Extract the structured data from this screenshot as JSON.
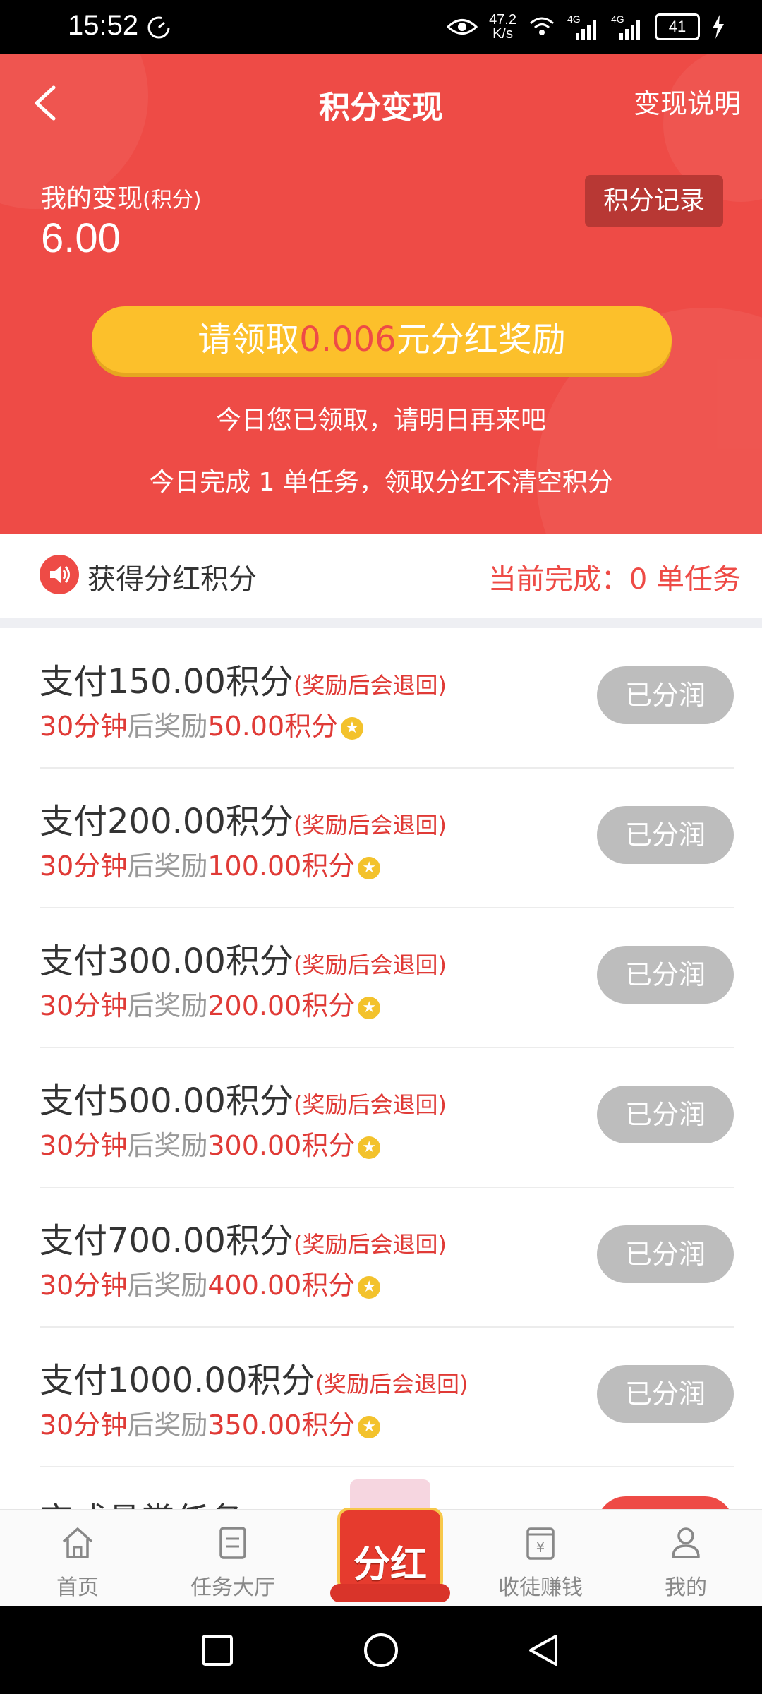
{
  "status_bar": {
    "time": "15:52",
    "net_speed_value": "47.2",
    "net_speed_unit": "K/s",
    "signal_label_1": "4G",
    "signal_label_2": "4G",
    "battery": "41"
  },
  "nav": {
    "title": "积分变现",
    "right_link": "变现说明"
  },
  "summary": {
    "label": "我的变现",
    "label_unit": "(积分)",
    "value": "6.00",
    "record_button": "积分记录"
  },
  "claim": {
    "prefix": "请领取",
    "amount": "0.006",
    "suffix": "元分红奖励"
  },
  "info": {
    "line1": "今日您已领取，请明日再来吧",
    "line2": "今日完成 1 单任务，领取分红不清空积分"
  },
  "section": {
    "title": "获得分红积分",
    "progress": "当前完成：0 单任务"
  },
  "tasks": [
    {
      "pay": "支付150.00积分",
      "note": "(奖励后会退回)",
      "time": "30分钟",
      "mid": "后奖励",
      "reward": "50.00积分",
      "status": "已分润"
    },
    {
      "pay": "支付200.00积分",
      "note": "(奖励后会退回)",
      "time": "30分钟",
      "mid": "后奖励",
      "reward": "100.00积分",
      "status": "已分润"
    },
    {
      "pay": "支付300.00积分",
      "note": "(奖励后会退回)",
      "time": "30分钟",
      "mid": "后奖励",
      "reward": "200.00积分",
      "status": "已分润"
    },
    {
      "pay": "支付500.00积分",
      "note": "(奖励后会退回)",
      "time": "30分钟",
      "mid": "后奖励",
      "reward": "300.00积分",
      "status": "已分润"
    },
    {
      "pay": "支付700.00积分",
      "note": "(奖励后会退回)",
      "time": "30分钟",
      "mid": "后奖励",
      "reward": "400.00积分",
      "status": "已分润"
    },
    {
      "pay": "支付1000.00积分",
      "note": "(奖励后会退回)",
      "time": "30分钟",
      "mid": "后奖励",
      "reward": "350.00积分",
      "status": "已分润"
    }
  ],
  "partial_task": {
    "title": "完成悬赏任务"
  },
  "bottom_nav": {
    "home": "首页",
    "tasks": "任务大厅",
    "center": "分红",
    "invite": "收徒赚钱",
    "mine": "我的"
  },
  "colors": {
    "brand_red": "#ee4b46",
    "gold": "#fcc02b",
    "disabled_grey": "#bdbdbd"
  }
}
